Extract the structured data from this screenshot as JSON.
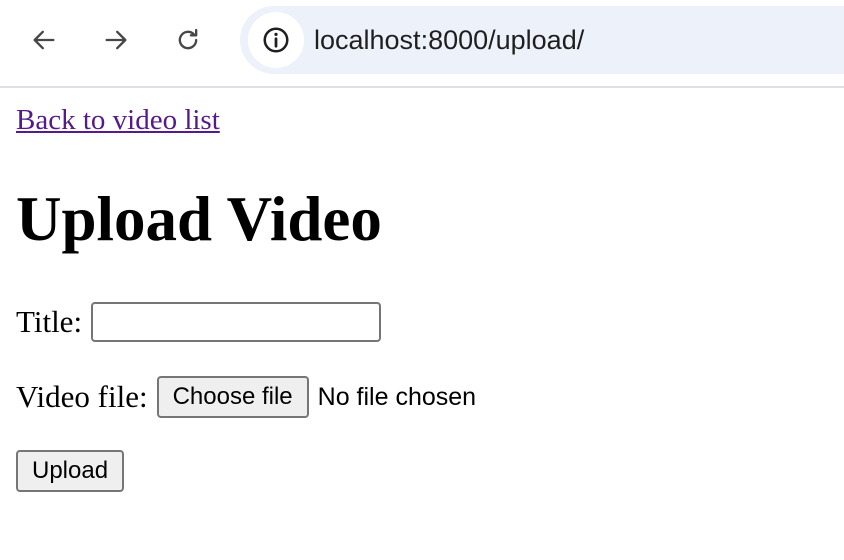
{
  "browser": {
    "back_icon": "arrow-left-icon",
    "forward_icon": "arrow-right-icon",
    "reload_icon": "reload-icon",
    "site_info_icon": "info-icon",
    "url": "localhost:8000/upload/",
    "omnibox_color": "#edf2fa"
  },
  "page": {
    "back_link": "Back to video list",
    "title": "Upload Video",
    "link_color": "#551a8b"
  },
  "form": {
    "title_label": "Title:",
    "title_value": "",
    "file_label": "Video file:",
    "choose_file_label": "Choose file",
    "file_status": "No file chosen",
    "submit_label": "Upload"
  }
}
